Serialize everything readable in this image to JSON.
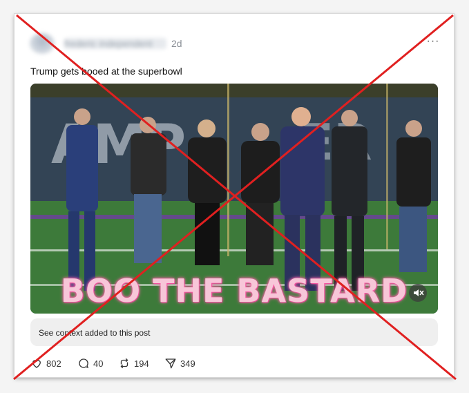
{
  "post": {
    "author": "frederic independent",
    "time": "2d",
    "more_label": "···",
    "text": "Trump gets booed at the superbowl"
  },
  "video": {
    "caption": "BOO THE BASTARD",
    "mute_icon": "speaker-muted-icon"
  },
  "context_note": "See context added to this post",
  "actions": {
    "likes": "802",
    "comments": "40",
    "reposts": "194",
    "shares": "349"
  },
  "overlay": {
    "cross_color": "#e02020"
  }
}
